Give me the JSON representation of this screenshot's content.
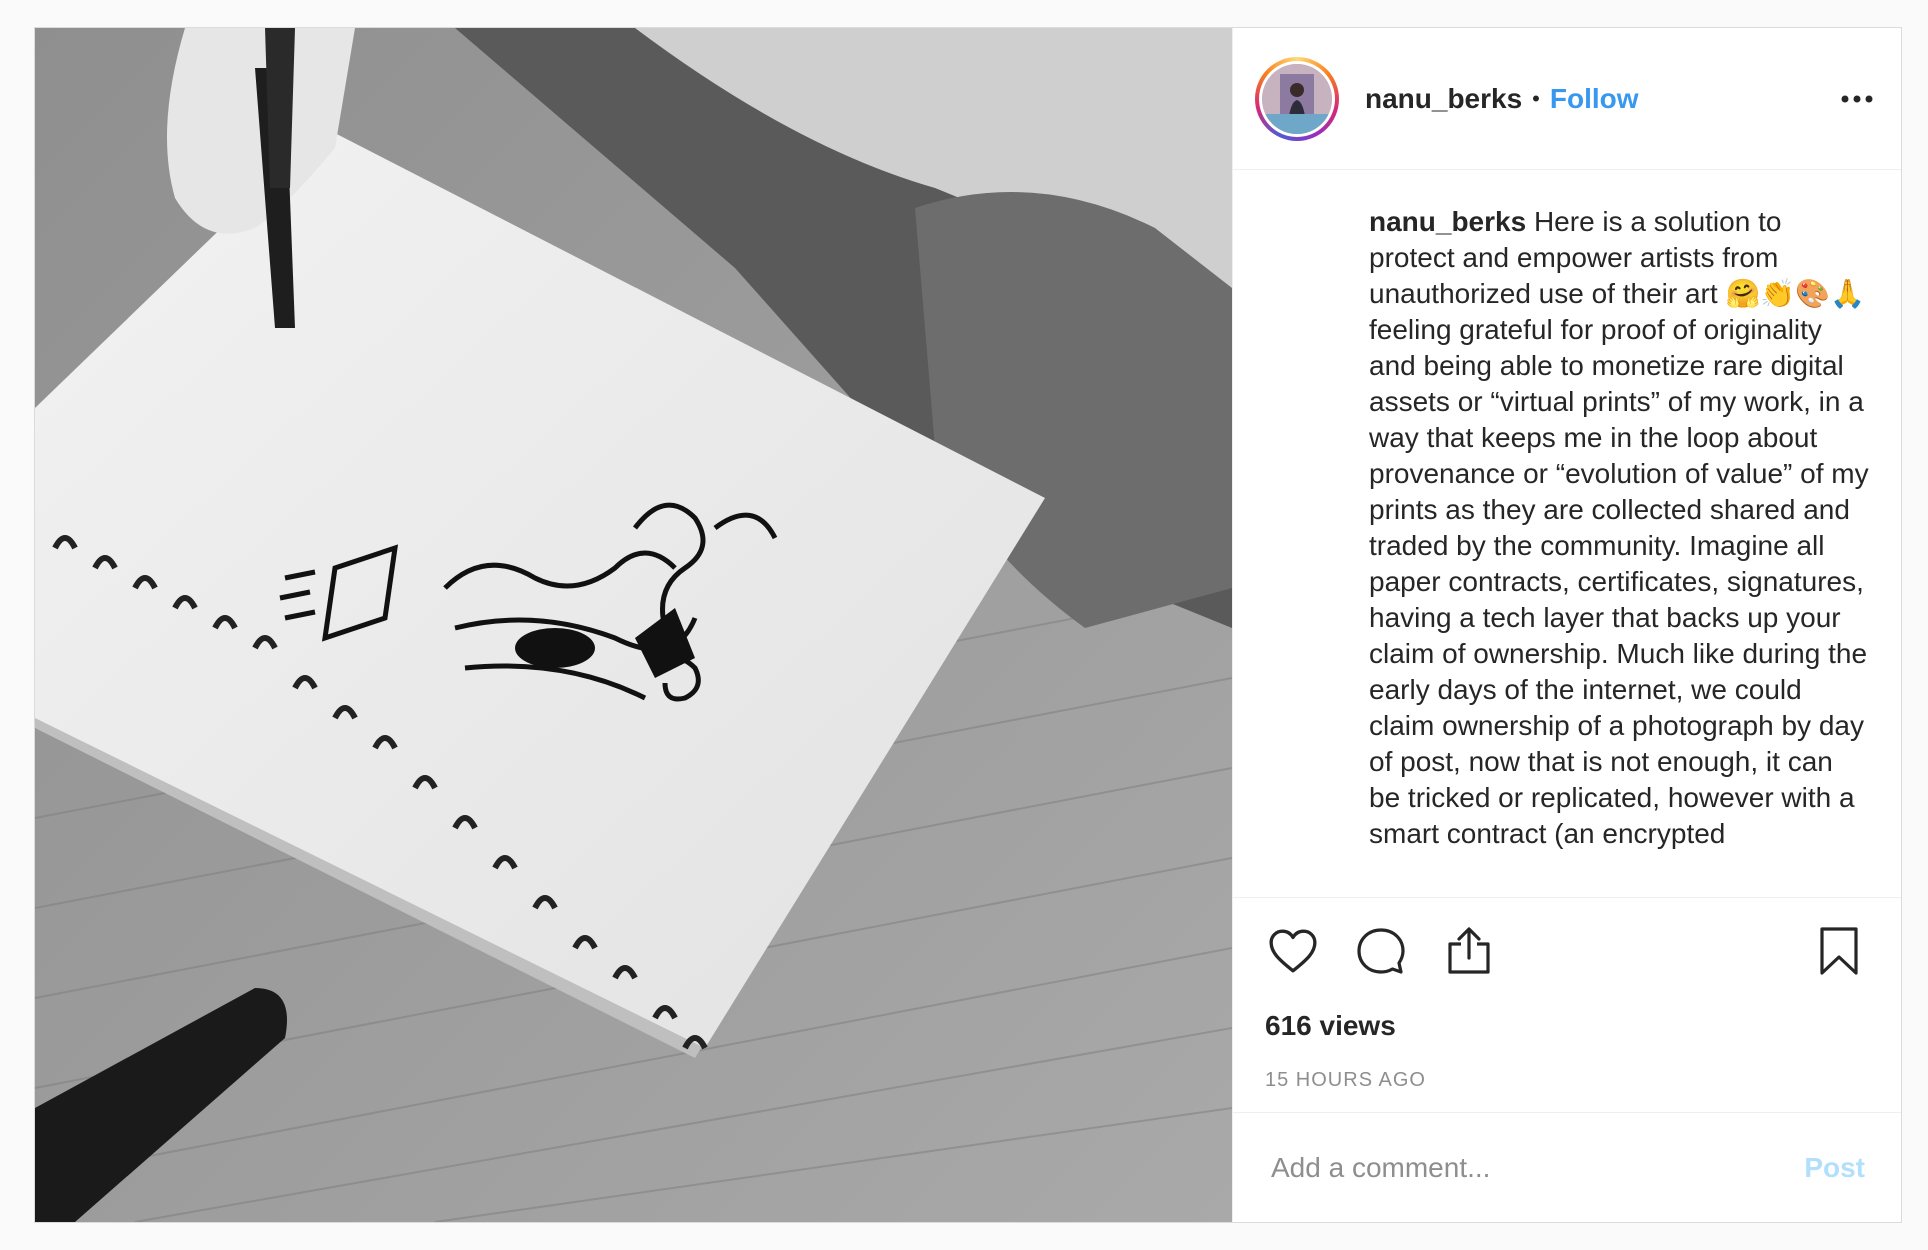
{
  "header": {
    "username": "nanu_berks",
    "separator": "•",
    "follow_label": "Follow",
    "more_icon": "more-horizontal-icon"
  },
  "caption": {
    "username": "nanu_berks",
    "text": "Here is a solution to protect and empower artists from unauthorized use of their art 🤗👏🎨🙏 feeling grateful for proof of originality and being able to monetize rare digital assets or “virtual prints” of my work, in a way that keeps me in the loop about provenance or “evolution of value” of my prints as they are collected shared and traded by the community. Imagine all paper contracts, certificates, signatures, having a tech layer that backs up your claim of ownership. Much like during the early days of the internet, we could claim ownership of a photograph by day of post, now that is not enough, it can be tricked or replicated, however with a smart contract (an encrypted"
  },
  "actions": {
    "like_icon": "heart-icon",
    "comment_icon": "comment-icon",
    "share_icon": "share-icon",
    "save_icon": "bookmark-icon"
  },
  "stats": {
    "views": "616 views",
    "time": "15 HOURS AGO"
  },
  "comment": {
    "placeholder": "Add a comment...",
    "post_label": "Post"
  },
  "colors": {
    "link": "#3897f0",
    "post_disabled": "#b2dffc",
    "muted": "#8e8e8e"
  }
}
